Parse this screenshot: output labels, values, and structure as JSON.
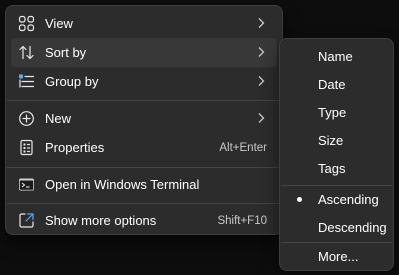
{
  "context_menu": {
    "items": [
      {
        "label": "View",
        "icon": "view-grid-icon",
        "has_submenu": true
      },
      {
        "label": "Sort by",
        "icon": "sort-arrows-icon",
        "has_submenu": true,
        "active": true
      },
      {
        "label": "Group by",
        "icon": "group-list-icon",
        "has_submenu": true
      },
      {
        "label": "New",
        "icon": "plus-circle-icon",
        "has_submenu": true
      },
      {
        "label": "Properties",
        "icon": "properties-icon",
        "shortcut": "Alt+Enter"
      },
      {
        "label": "Open in Windows Terminal",
        "icon": "terminal-icon"
      },
      {
        "label": "Show more options",
        "icon": "show-more-options-icon",
        "shortcut": "Shift+F10"
      }
    ]
  },
  "sort_submenu": {
    "items": [
      {
        "label": "Name"
      },
      {
        "label": "Date"
      },
      {
        "label": "Type"
      },
      {
        "label": "Size"
      },
      {
        "label": "Tags"
      },
      {
        "label": "Ascending",
        "selected": true
      },
      {
        "label": "Descending"
      },
      {
        "label": "More..."
      }
    ]
  },
  "colors": {
    "menu_background": "#2c2c2c",
    "hover_background": "#383838",
    "separator": "#444444",
    "text": "#ffffff",
    "shortcut_text": "#c9c9c9",
    "desktop_background": "#0d0d0d"
  }
}
